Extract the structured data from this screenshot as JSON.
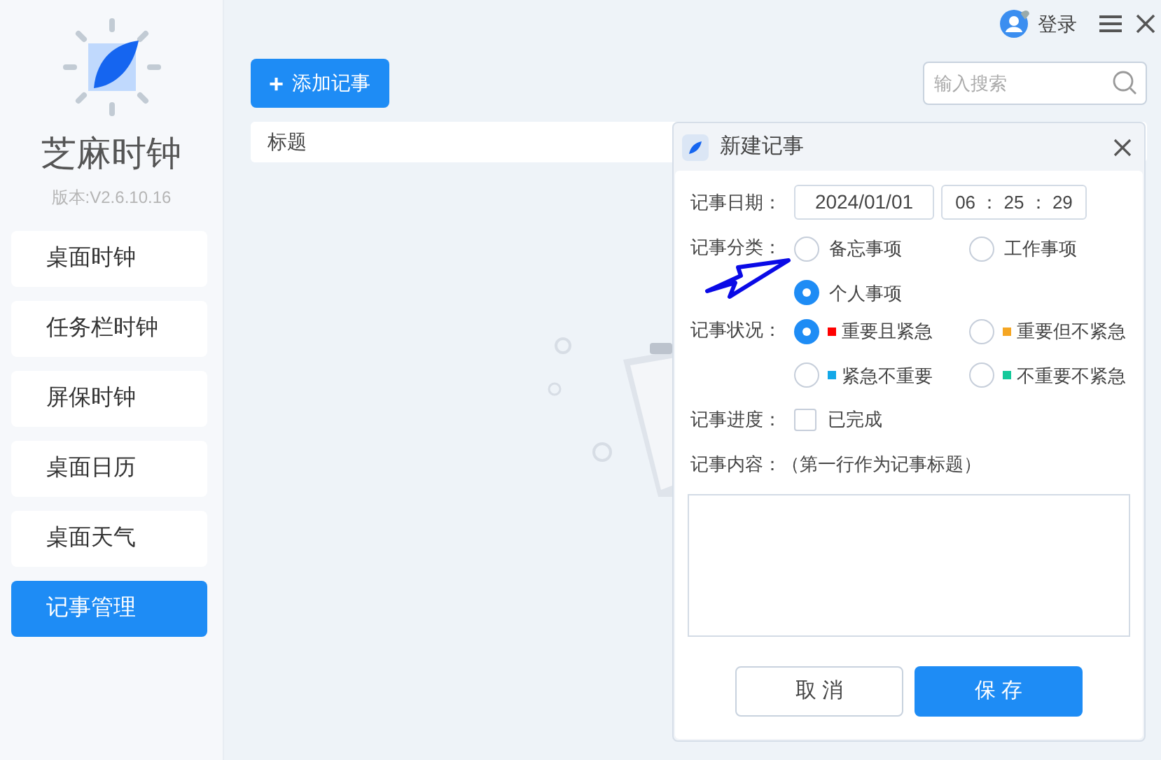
{
  "app": {
    "name": "芝麻时钟",
    "version": "版本:V2.6.10.16"
  },
  "sidebar": {
    "items": [
      {
        "label": "桌面时钟",
        "selected": false
      },
      {
        "label": "任务栏时钟",
        "selected": false
      },
      {
        "label": "屏保时钟",
        "selected": false
      },
      {
        "label": "桌面日历",
        "selected": false
      },
      {
        "label": "桌面天气",
        "selected": false
      },
      {
        "label": "记事管理",
        "selected": true
      }
    ]
  },
  "header": {
    "login": "登录"
  },
  "toolbar": {
    "add_icon": "+",
    "add_button": "添加记事",
    "search": {
      "placeholder": "输入搜索"
    }
  },
  "table": {
    "columns": [
      "标题"
    ]
  },
  "dialog": {
    "title": "新建记事",
    "date": {
      "label": "记事日期：",
      "date": "2024/01/01",
      "time_parts": [
        "06",
        "：",
        "25",
        "：",
        "29"
      ]
    },
    "category": {
      "label": "记事分类：",
      "options": [
        {
          "label": "备忘事项",
          "selected": false
        },
        {
          "label": "工作事项",
          "selected": false
        },
        {
          "label": "个人事项",
          "selected": true
        }
      ]
    },
    "status": {
      "label": "记事状况：",
      "options": [
        {
          "label": "重要且紧急",
          "color": "#ff0000",
          "selected": true
        },
        {
          "label": "重要但不紧急",
          "color": "#f5a623",
          "selected": false
        },
        {
          "label": "紧急不重要",
          "color": "#13a8e8",
          "selected": false
        },
        {
          "label": "不重要不紧急",
          "color": "#14c99a",
          "selected": false
        }
      ]
    },
    "progress": {
      "label": "记事进度：",
      "option": "已完成",
      "checked": false
    },
    "content": {
      "label": "记事内容：（第一行作为记事标题）"
    },
    "buttons": [
      {
        "label": "取 消",
        "kind": "secondary"
      },
      {
        "label": "保 存",
        "kind": "primary"
      }
    ]
  },
  "annotation_arrow": true
}
